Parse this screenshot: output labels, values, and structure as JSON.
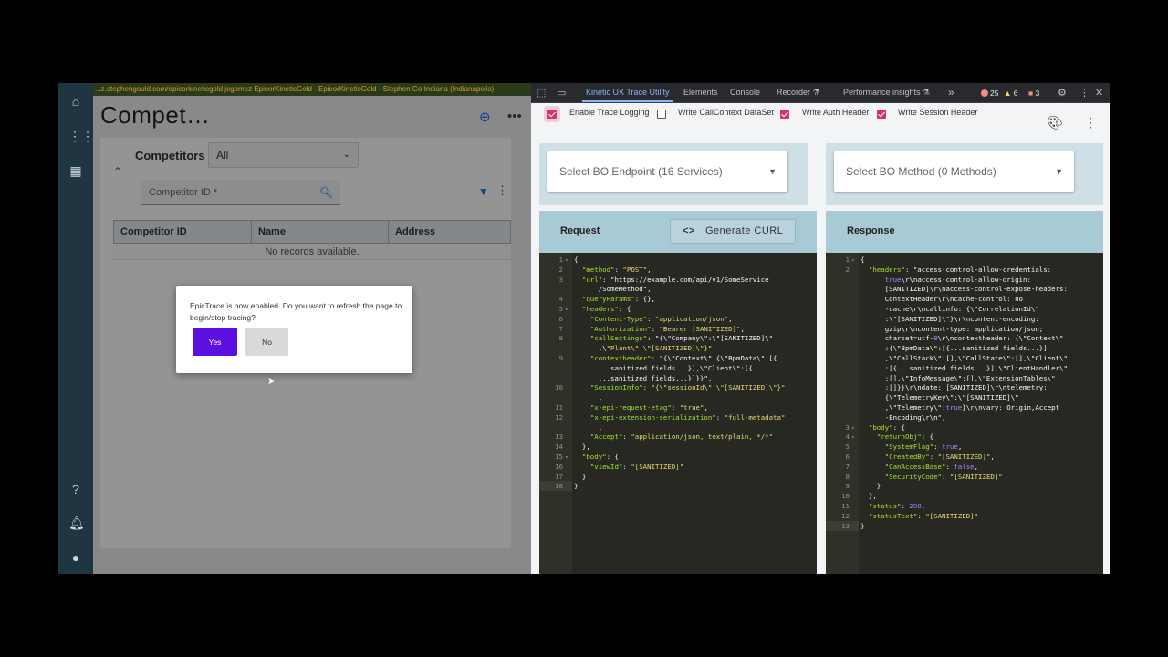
{
  "app": {
    "url_bar": "...z.stephengould.com/epicorkineticgold   jcgomez   EpicorKineticGold - EpicorKineticGold - Stephen Go   Indiana (Indianapolis)",
    "title": "Compet…",
    "competitors_label": "Competitors",
    "filter_value": "All",
    "competitor_id_placeholder": "Competitor ID *",
    "grid": {
      "columns": [
        "Competitor ID",
        "Name",
        "Address"
      ],
      "empty_text": "No records available."
    },
    "nav_icons": [
      "home-icon",
      "apps-icon",
      "dashboard-icon",
      "help-icon",
      "bell-icon",
      "user-icon"
    ],
    "dialog": {
      "message": "EpicTrace is now enabled. Do you want to refresh the page to begin/stop tracing?",
      "yes_label": "Yes",
      "no_label": "No"
    }
  },
  "devtools": {
    "tabs": [
      {
        "label": "Kinetic UX Trace Utility",
        "active": true
      },
      {
        "label": "Elements",
        "active": false
      },
      {
        "label": "Console",
        "active": false
      },
      {
        "label": "Recorder ⚗",
        "active": false
      },
      {
        "label": "Performance insights ⚗",
        "active": false
      }
    ],
    "more_tabs": "»",
    "error_count": "25",
    "warning_count": "6",
    "issue_count": "3",
    "colors": {
      "error": "#f28b82",
      "warning": "#fdd663",
      "issue": "#f28b82",
      "accent": "#8ab4f8"
    }
  },
  "trace": {
    "options": [
      {
        "label": "Enable Trace Logging",
        "checked": true
      },
      {
        "label": "Write CallContext DataSet",
        "checked": false
      },
      {
        "label": "Write Auth Header",
        "checked": true
      },
      {
        "label": "Write Session Header",
        "checked": true
      }
    ],
    "endpoint_select": "Select BO Endpoint (16 Services)",
    "method_select": "Select BO Method (0 Methods)",
    "request_title": "Request",
    "curl_button": "Generate CURL",
    "curl_icon": "<>",
    "response_title": "Response",
    "request_lines": [
      {
        "n": "1",
        "fold": true,
        "t": "{"
      },
      {
        "n": "2",
        "t": "  \"method\": \"POST\","
      },
      {
        "n": "3",
        "t": "  \"url\": \"https://example.com/api/v1/SomeService"
      },
      {
        "n": "",
        "t": "      /SomeMethod\","
      },
      {
        "n": "4",
        "t": "  \"queryParams\": {},"
      },
      {
        "n": "5",
        "fold": true,
        "t": "  \"headers\": {"
      },
      {
        "n": "6",
        "t": "    \"Content-Type\": \"application/json\","
      },
      {
        "n": "7",
        "t": "    \"Authorization\": \"Bearer [SANITIZED]\","
      },
      {
        "n": "8",
        "t": "    \"callSettings\": \"{\\\"Company\\\":\\\"[SANITIZED]\\\""
      },
      {
        "n": "",
        "t": "      ,\\\"Plant\\\":\\\"[SANITIZED]\\\"}\","
      },
      {
        "n": "9",
        "t": "    \"contextheader\": \"{\\\"Context\\\":{\\\"BpmData\\\":[{"
      },
      {
        "n": "",
        "t": "      ...sanitized fields...}],\\\"Client\\\":[{"
      },
      {
        "n": "",
        "t": "      ...sanitized fields...}]}}\","
      },
      {
        "n": "10",
        "t": "    \"SessionInfo\": \"{\\\"sessionId\\\":\\\"[SANITIZED]\\\"}\""
      },
      {
        "n": "",
        "t": "      ,"
      },
      {
        "n": "11",
        "t": "    \"x-epi-request-etag\": \"true\","
      },
      {
        "n": "12",
        "t": "    \"x-epi-extension-serialization\": \"full-metadata\""
      },
      {
        "n": "",
        "t": "      ,"
      },
      {
        "n": "13",
        "t": "    \"Accept\": \"application/json, text/plain, */*\""
      },
      {
        "n": "14",
        "t": "  },"
      },
      {
        "n": "15",
        "fold": true,
        "t": "  \"body\": {"
      },
      {
        "n": "16",
        "t": "    \"viewId\": \"[SANITIZED]\""
      },
      {
        "n": "17",
        "t": "  }"
      },
      {
        "n": "18",
        "active": true,
        "t": "}"
      }
    ],
    "response_lines": [
      {
        "n": "1",
        "fold": true,
        "t": "{"
      },
      {
        "n": "2",
        "t": "  \"headers\": \"access-control-allow-credentials:"
      },
      {
        "n": "",
        "t": "      true\\r\\naccess-control-allow-origin:"
      },
      {
        "n": "",
        "t": "      [SANITIZED]\\r\\naccess-control-expose-headers:"
      },
      {
        "n": "",
        "t": "      ContextHeader\\r\\ncache-control: no"
      },
      {
        "n": "",
        "t": "      -cache\\r\\ncallinfo: {\\\"CorrelationId\\\""
      },
      {
        "n": "",
        "t": "      :\\\"[SANITIZED]\\\"}\\r\\ncontent-encoding:"
      },
      {
        "n": "",
        "t": "      gzip\\r\\ncontent-type: application/json;"
      },
      {
        "n": "",
        "t": "      charset=utf-8\\r\\ncontextheader: {\\\"Context\\\""
      },
      {
        "n": "",
        "t": "      :{\\\"BpmData\\\":[{...sanitized fields...}]"
      },
      {
        "n": "",
        "t": "      ,\\\"CallStack\\\":[],\\\"CallState\\\":[],\\\"Client\\\""
      },
      {
        "n": "",
        "t": "      :[{...sanitized fields...}],\\\"ClientHandler\\\""
      },
      {
        "n": "",
        "t": "      :[],\\\"InfoMessage\\\":[],\\\"ExtensionTables\\\""
      },
      {
        "n": "",
        "t": "      :[]}}\\r\\ndate: [SANITIZED]\\r\\ntelemetry:"
      },
      {
        "n": "",
        "t": "      {\\\"TelemetryKey\\\":\\\"[SANITIZED]\\\""
      },
      {
        "n": "",
        "t": "      ,\\\"Telemetry\\\":true}\\r\\nvary: Origin,Accept"
      },
      {
        "n": "",
        "t": "      -Encoding\\r\\n\","
      },
      {
        "n": "3",
        "fold": true,
        "t": "  \"body\": {"
      },
      {
        "n": "4",
        "fold": true,
        "t": "    \"returnObj\": {"
      },
      {
        "n": "5",
        "t": "      \"SystemFlag\": true,"
      },
      {
        "n": "6",
        "t": "      \"CreatedBy\": \"[SANITIZED]\","
      },
      {
        "n": "7",
        "t": "      \"CanAccessBase\": false,"
      },
      {
        "n": "8",
        "t": "      \"SecurityCode\": \"[SANITIZED]\""
      },
      {
        "n": "9",
        "t": "    }"
      },
      {
        "n": "10",
        "t": "  },"
      },
      {
        "n": "11",
        "t": "  \"status\": 200,"
      },
      {
        "n": "12",
        "t": "  \"statusText\": \"[SANITIZED]\""
      },
      {
        "n": "13",
        "active": true,
        "t": "}"
      }
    ]
  }
}
